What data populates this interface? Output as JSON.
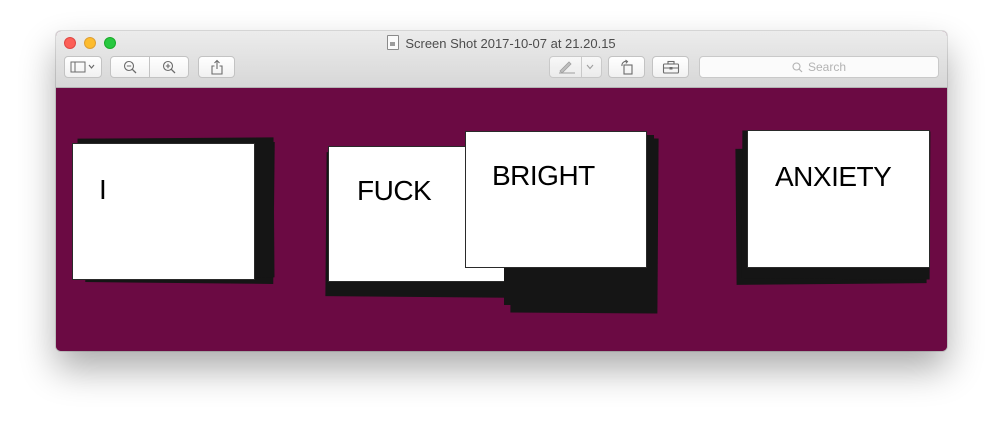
{
  "window": {
    "title": "Screen Shot 2017-10-07 at 21.20.15"
  },
  "toolbar": {
    "sidebar_button": "sidebar-toggle-icon",
    "zoom_out": "zoom-out-icon",
    "zoom_in": "zoom-in-icon",
    "share": "share-icon",
    "markup": "pen-icon",
    "rotate": "rotate-icon",
    "toolbox": "toolbox-icon",
    "search_placeholder": "Search"
  },
  "colors": {
    "background": "#6b0a43",
    "card": "#ffffff",
    "stack": "#151515"
  },
  "cards": {
    "card1": "I",
    "card2": "FUCK",
    "card3": "BRIGHT",
    "card4": "ANXIETY"
  }
}
